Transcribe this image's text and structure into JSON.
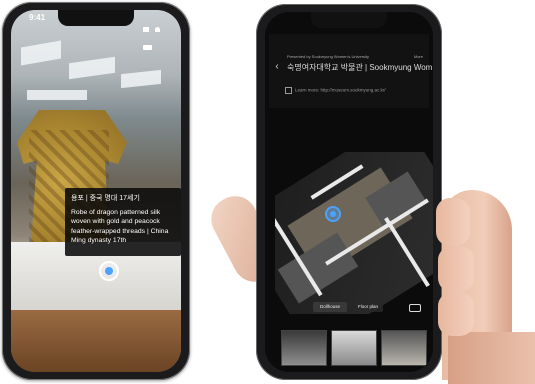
{
  "left_phone": {
    "status_time": "9:41",
    "card_title": "용포 | 중국 명대 17세기",
    "card_description": "Robe of dragon patterned silk woven with gold and peacock feather-wrapped threads | China Ming dynasty 17th"
  },
  "right_phone": {
    "presented_by": "Presented by Sookmyung Women's University",
    "more_label": "More",
    "back_glyph": "‹",
    "museum_title": "숙명여자대학교 박물관 | Sookmyung Wom",
    "learn_more": "Learn more: http://museum.sookmyung.ac.kr/",
    "tab_dollhouse": "Dollhouse",
    "tab_floorplan": "Floor plan"
  },
  "icons": {
    "hotspot": "hotspot-icon",
    "location_marker": "location-marker-icon",
    "back": "back-icon",
    "vr": "vr-headset-icon",
    "link": "link-icon"
  },
  "colors": {
    "accent_blue": "#4aa3ff",
    "card_bg": "#0a0a0a"
  }
}
